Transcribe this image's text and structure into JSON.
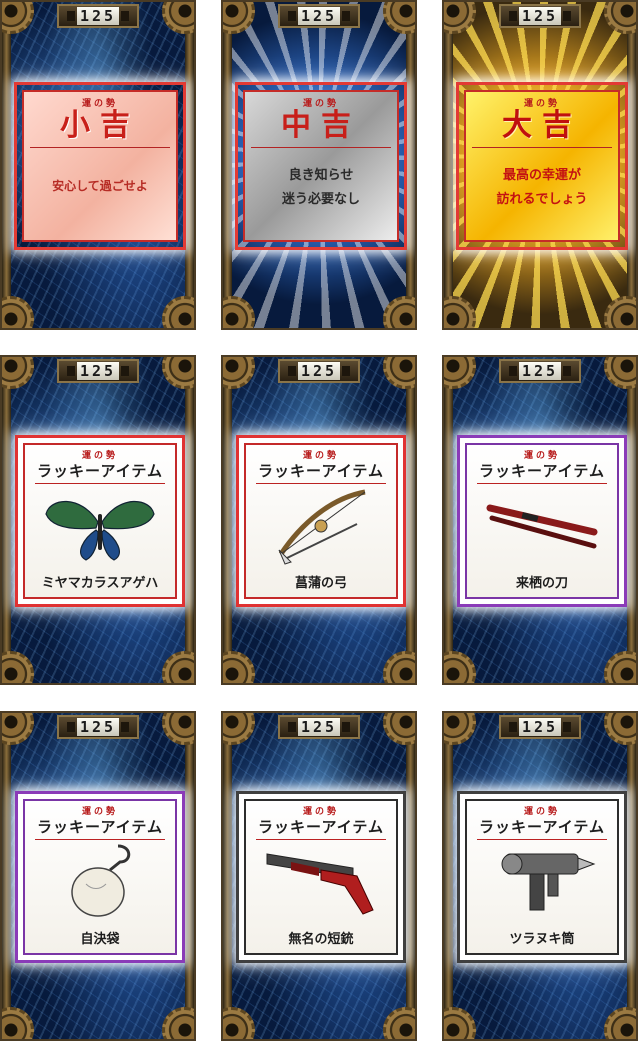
{
  "counter_value": "125",
  "fortune_tag": "運の勢",
  "fortune_cards": [
    {
      "id": "shokichi",
      "rank": "小吉",
      "message_lines": [
        "安心して過ごせよ"
      ],
      "theme": "red"
    },
    {
      "id": "chukichi",
      "rank": "中吉",
      "message_lines": [
        "良き知らせ",
        "迷う必要なし"
      ],
      "theme": "silver"
    },
    {
      "id": "daikichi",
      "rank": "大吉",
      "message_lines": [
        "最高の幸運が",
        "訪れるでしょう"
      ],
      "theme": "gold"
    }
  ],
  "item_title": "ラッキーアイテム",
  "item_cards": [
    {
      "id": "butterfly",
      "name": "ミヤマカラスアゲハ",
      "icon": "butterfly-icon",
      "border_color": "#e03232"
    },
    {
      "id": "bow",
      "name": "菖蒲の弓",
      "icon": "bow-icon",
      "border_color": "#e03232"
    },
    {
      "id": "sword",
      "name": "来栖の刀",
      "icon": "katana-icon",
      "border_color": "#8a3bb8"
    },
    {
      "id": "bag",
      "name": "自決袋",
      "icon": "hook-bag-icon",
      "border_color": "#8a3bb8"
    },
    {
      "id": "shotgun",
      "name": "無名の短銃",
      "icon": "shotgun-icon",
      "border_color": "#3f3f3f"
    },
    {
      "id": "blaster",
      "name": "ツラヌキ筒",
      "icon": "blaster-icon",
      "border_color": "#3f3f3f"
    }
  ]
}
